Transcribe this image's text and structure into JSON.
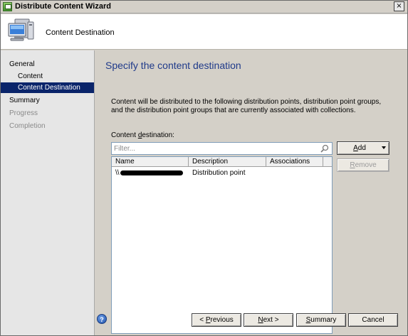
{
  "window": {
    "title": "Distribute Content Wizard",
    "close_glyph": "×"
  },
  "header": {
    "title": "Content Destination",
    "icon": "computer-monitor-icon"
  },
  "nav": {
    "items": [
      {
        "label": "General",
        "state": "normal"
      },
      {
        "label": "Content",
        "state": "normal"
      },
      {
        "label": "Content Destination",
        "state": "selected"
      },
      {
        "label": "Summary",
        "state": "normal"
      },
      {
        "label": "Progress",
        "state": "disabled"
      },
      {
        "label": "Completion",
        "state": "disabled"
      }
    ]
  },
  "main": {
    "page_title": "Specify the content destination",
    "description": "Content will be distributed to the following distribution points, distribution point groups, and the distribution point groups that are currently associated with collections.",
    "dest_label_pre": "Content ",
    "dest_label_accel": "d",
    "dest_label_post": "estination:",
    "filter_placeholder": "Filter...",
    "columns": [
      "Name",
      "Description",
      "Associations"
    ],
    "rows": [
      {
        "name_prefix": "\\\\",
        "name_redacted": true,
        "description": "Distribution point",
        "associations": ""
      }
    ]
  },
  "buttons": {
    "add": "Add",
    "add_accel": "A",
    "add_rest": "dd",
    "remove": "Remove",
    "remove_accel": "R",
    "remove_rest": "emove",
    "previous_pre": "< ",
    "previous_accel": "P",
    "previous_rest": "revious",
    "next_accel": "N",
    "next_rest": "ext >",
    "summary_accel": "S",
    "summary_rest": "ummary",
    "cancel": "Cancel",
    "help_glyph": "?"
  },
  "colors": {
    "nav_selected": "#0a246a",
    "page_title": "#1f3a8a",
    "window_bg": "#d4d0c8"
  }
}
